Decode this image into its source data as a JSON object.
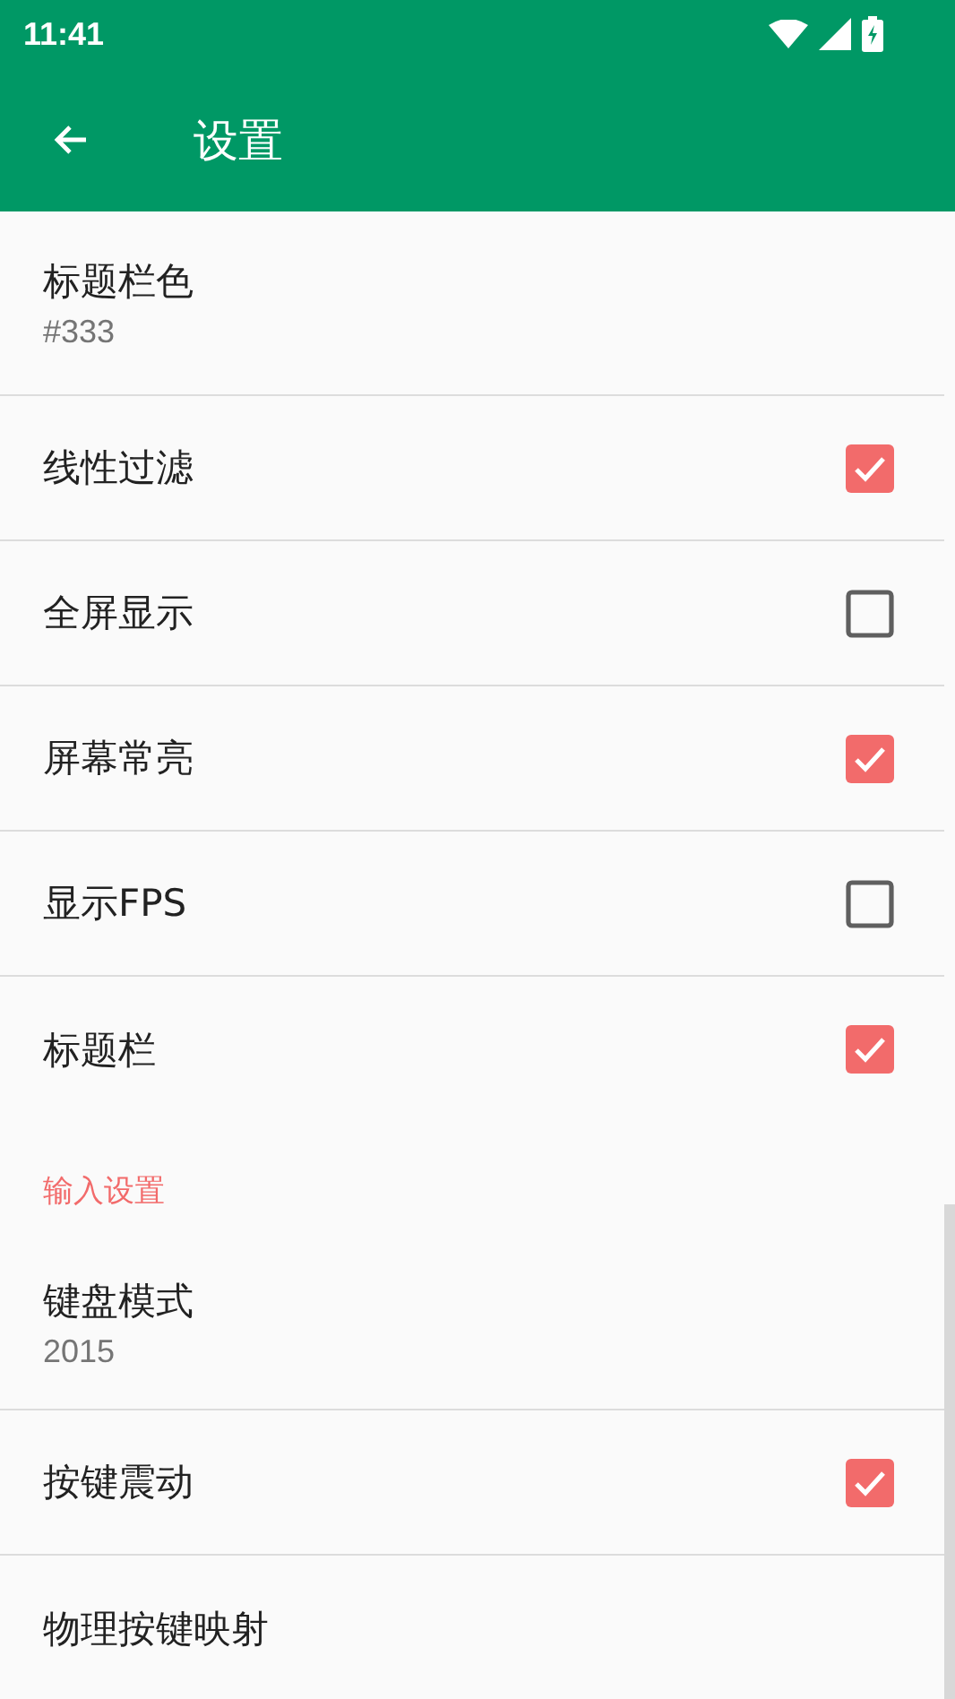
{
  "status_bar": {
    "time": "11:41"
  },
  "toolbar": {
    "title": "设置"
  },
  "items": [
    {
      "kind": "summary",
      "title": "标题栏色",
      "summary": "#333"
    },
    {
      "kind": "checkbox",
      "title": "线性过滤",
      "checked": true
    },
    {
      "kind": "checkbox",
      "title": "全屏显示",
      "checked": false
    },
    {
      "kind": "checkbox",
      "title": "屏幕常亮",
      "checked": true
    },
    {
      "kind": "checkbox",
      "title": "显示FPS",
      "checked": false
    },
    {
      "kind": "checkbox",
      "title": "标题栏",
      "checked": true
    },
    {
      "kind": "category",
      "title": "输入设置"
    },
    {
      "kind": "summary",
      "title": "键盘模式",
      "summary": "2015"
    },
    {
      "kind": "checkbox",
      "title": "按键震动",
      "checked": true
    },
    {
      "kind": "plain",
      "title": "物理按键映射"
    }
  ]
}
